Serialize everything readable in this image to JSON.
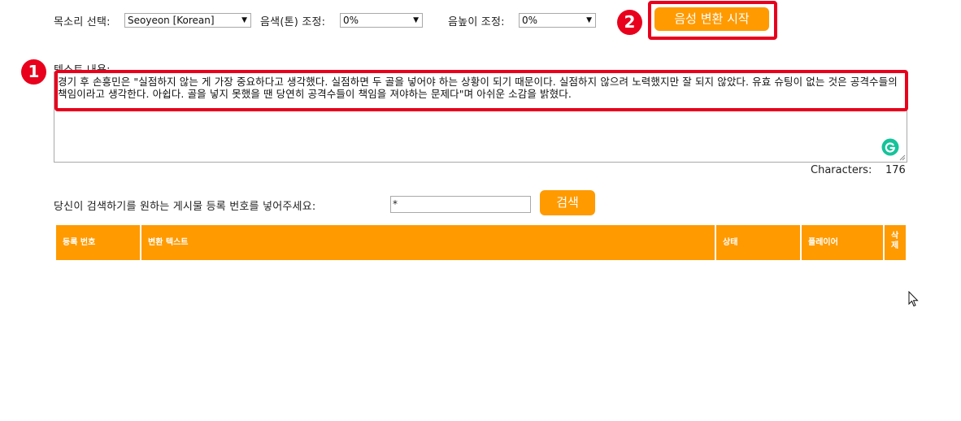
{
  "controls": {
    "voice_label": "목소리 선택:",
    "voice_value": "Seoyeon [Korean]",
    "tone_label": "음색(톤) 조정:",
    "tone_value": "0%",
    "pitch_label": "음높이 조정:",
    "pitch_value": "0%",
    "start_button": "음성 변환 시작"
  },
  "text_area": {
    "label": "텍스트 내용:",
    "content": "경기 후 손흥민은 \"실점하지 않는 게 가장 중요하다고 생각했다. 실점하면 두 골을 넣어야 하는 상황이 되기 때문이다. 실점하지 않으려 노력했지만 잘 되지 않았다. 유효 슈팅이 없는 것은 공격수들의 책임이라고 생각한다. 아쉽다. 골을 넣지 못했을 땐 당연히 공격수들이 책임을 져야하는 문제다\"며 아쉬운 소감을 밝혔다.",
    "char_label": "Characters:",
    "char_count": "176"
  },
  "search": {
    "label": "당신이 검색하기를 원하는 게시물 등록 번호를 넣어주세요:",
    "value": "*",
    "button": "검색"
  },
  "table": {
    "headers": [
      "등록 번호",
      "변환 텍스트",
      "상태",
      "플레이어",
      "삭제"
    ]
  },
  "annotations": {
    "badge_1": "1",
    "badge_2": "2"
  },
  "colors": {
    "accent": "#ff9a00",
    "highlight": "#e8001c"
  }
}
